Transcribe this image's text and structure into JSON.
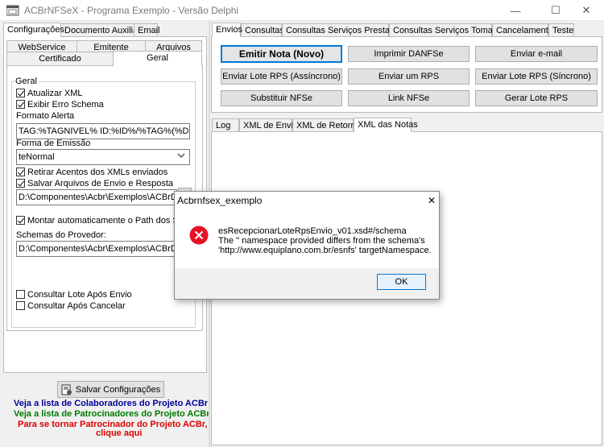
{
  "window": {
    "title": "ACBrNFSeX - Programa Exemplo - Versão Delphi",
    "controls": {
      "minimize": "—",
      "maximize": "☐",
      "close": "✕"
    }
  },
  "left": {
    "tabs": [
      "Configurações",
      "Documento Auxiliar",
      "Email"
    ],
    "subtabs_row1": [
      "WebService",
      "Emitente",
      "Arquivos"
    ],
    "subtabs_row2": [
      "Certificado",
      "Geral"
    ],
    "group_label": "Geral",
    "atualizar_xml": "Atualizar XML",
    "exibir_erro_schema": "Exibir Erro Schema",
    "formato_alerta_label": "Formato Alerta",
    "formato_alerta_value": "TAG:%TAGNIVEL% ID:%ID%/%TAG%(%DESCRI",
    "forma_emissao_label": "Forma de Emissão",
    "forma_emissao_value": "teNormal",
    "retirar_acentos": "Retirar Acentos dos XMLs enviados",
    "salvar_arquivos": "Salvar Arquivos de Envio e Resposta",
    "path_envio": "D:\\Componentes\\Acbr\\Exemplos\\ACBrDFe\\ACI",
    "montar_path": "Montar automaticamente o Path dos Schema",
    "schemas_label": "Schemas do Provedor:",
    "schemas_path": "D:\\Componentes\\Acbr\\Exemplos\\ACBrDFe\\Sch",
    "consultar_lote": "Consultar Lote Após Envio",
    "consultar_apos_cancelar": "Consultar Após Cancelar",
    "salvar_config": "Salvar Configurações",
    "links": {
      "colaboradores": "Veja a lista de Colaboradores do Projeto ACBr",
      "patrocinadores": "Veja a lista de Patrocinadores do Projeto ACBr",
      "patrocinador1": "Para se tornar Patrocinador do Projeto ACBr,",
      "patrocinador2": "clique aqui"
    },
    "colors": {
      "blue": "#000099",
      "green": "#007a00",
      "red": "#dd0000"
    }
  },
  "right": {
    "tabs": [
      "Envios",
      "Consultas",
      "Consultas Serviços Prestados",
      "Consultas Serviços Tomados",
      "Cancelamento",
      "Teste"
    ],
    "buttons": {
      "emitir": "Emitir Nota (Novo)",
      "imprimir": "Imprimir DANFSe",
      "email": "Enviar e-mail",
      "lote_async": "Enviar Lote RPS (Assíncrono)",
      "enviar_um": "Enviar um RPS",
      "lote_sync": "Enviar Lote RPS (Síncrono)",
      "substituir": "Substituir NFSe",
      "link": "Link NFSe",
      "gerar_lote": "Gerar Lote RPS"
    },
    "log_tabs": [
      "Log",
      "XML de Envio",
      "XML de Retorno",
      "XML das Notas"
    ]
  },
  "dialog": {
    "title": "Acbrnfsex_exemplo",
    "line1": "esRecepcionarLoteRpsEnvio_v01.xsd#/schema",
    "line2": "The '' namespace provided differs from the schema's",
    "line3": "'http://www.equiplano.com.br/esnfs' targetNamespace.",
    "ok": "OK"
  }
}
